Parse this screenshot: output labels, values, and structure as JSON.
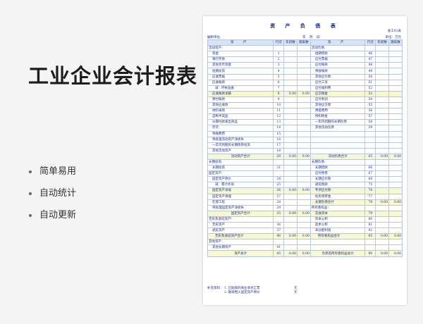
{
  "promo": {
    "title": "工业企业会计报表",
    "features": [
      "简单易用",
      "自动统计",
      "自动更新"
    ]
  },
  "sheet": {
    "title": "资 产 负 债 表",
    "form_no": "会工01表",
    "unit_label": "编制单位:",
    "date_text": "年 月 日",
    "money_unit": "单位：万元",
    "headers": {
      "asset": "资 产",
      "line": "行次",
      "begin": "年初数",
      "end": "期末数",
      "liability": "资 产",
      "line2": "行次",
      "begin2": "年初数",
      "end2": "期末数"
    },
    "rows": [
      {
        "a": "流动资产:",
        "an": "",
        "ab": "",
        "ae": "",
        "l": "流动负债:",
        "ln": "",
        "lb": "",
        "le": "",
        "ai": 0,
        "li": 0,
        "hl": false
      },
      {
        "a": "现金",
        "an": "1",
        "ab": "",
        "ae": "",
        "l": "短期借款",
        "ln": "46",
        "lb": "",
        "le": "",
        "ai": 1,
        "li": 1,
        "hl": false
      },
      {
        "a": "银行存款",
        "an": "2",
        "ab": "",
        "ae": "",
        "l": "应付票据",
        "ln": "47",
        "lb": "",
        "le": "",
        "ai": 1,
        "li": 1,
        "hl": false
      },
      {
        "a": "其他货币资金",
        "an": "3",
        "ab": "",
        "ae": "",
        "l": "应付账款",
        "ln": "48",
        "lb": "",
        "le": "",
        "ai": 1,
        "li": 1,
        "hl": false
      },
      {
        "a": "短期投资",
        "an": "4",
        "ab": "",
        "ae": "",
        "l": "预收账款",
        "ln": "49",
        "lb": "",
        "le": "",
        "ai": 1,
        "li": 1,
        "hl": false
      },
      {
        "a": "应收票据",
        "an": "5",
        "ab": "",
        "ae": "",
        "l": "其他应付款",
        "ln": "50",
        "lb": "",
        "le": "",
        "ai": 1,
        "li": 1,
        "hl": false
      },
      {
        "a": "应收账款",
        "an": "6",
        "ab": "",
        "ae": "",
        "l": "应付工资",
        "ln": "51",
        "lb": "",
        "le": "",
        "ai": 1,
        "li": 1,
        "hl": false
      },
      {
        "a": "减：坏帐准备",
        "an": "7",
        "ab": "",
        "ae": "",
        "l": "应付福利费",
        "ln": "52",
        "lb": "",
        "le": "",
        "ai": 2,
        "li": 1,
        "hl": false
      },
      {
        "a": "应收账款净额",
        "an": "8",
        "ab": "0.00",
        "ae": "0.00",
        "l": "应交税金",
        "ln": "53",
        "lb": "",
        "le": "",
        "ai": 1,
        "li": 1,
        "hl": true
      },
      {
        "a": "预付账款",
        "an": "9",
        "ab": "",
        "ae": "",
        "l": "应付利润",
        "ln": "54",
        "lb": "",
        "le": "",
        "ai": 1,
        "li": 1,
        "hl": false
      },
      {
        "a": "其他应收款",
        "an": "10",
        "ab": "",
        "ae": "",
        "l": "其他应交款",
        "ln": "55",
        "lb": "",
        "le": "",
        "ai": 1,
        "li": 1,
        "hl": false
      },
      {
        "a": "材料采购",
        "an": "11",
        "ab": "",
        "ae": "",
        "l": "预提费用",
        "ln": "56",
        "lb": "",
        "le": "",
        "ai": 1,
        "li": 1,
        "hl": false
      },
      {
        "a": "自制半成品",
        "an": "12",
        "ab": "",
        "ae": "",
        "l": "待扣税金",
        "ln": "57",
        "lb": "",
        "le": "",
        "ai": 1,
        "li": 1,
        "hl": false
      },
      {
        "a": "分期付款发出商品",
        "an": "13",
        "ab": "",
        "ae": "",
        "l": "一年内到期的长期负债",
        "ln": "58",
        "lb": "",
        "le": "",
        "ai": 1,
        "li": 1,
        "hl": false
      },
      {
        "a": "存货",
        "an": "14",
        "ab": "",
        "ae": "",
        "l": "其他流动负债",
        "ln": "59",
        "lb": "",
        "le": "",
        "ai": 1,
        "li": 1,
        "hl": false
      },
      {
        "a": "待摊费用",
        "an": "15",
        "ab": "",
        "ae": "",
        "l": "",
        "ln": "",
        "lb": "",
        "le": "",
        "ai": 1,
        "li": 1,
        "hl": false
      },
      {
        "a": "待处理流动资产净损失",
        "an": "16",
        "ab": "",
        "ae": "",
        "l": "",
        "ln": "",
        "lb": "",
        "le": "",
        "ai": 1,
        "li": 1,
        "hl": false
      },
      {
        "a": "一年内到期的长期债券投资",
        "an": "17",
        "ab": "",
        "ae": "",
        "l": "",
        "ln": "",
        "lb": "",
        "le": "",
        "ai": 1,
        "li": 1,
        "hl": false
      },
      {
        "a": "其他流动资产",
        "an": "18",
        "ab": "",
        "ae": "",
        "l": "",
        "ln": "",
        "lb": "",
        "le": "",
        "ai": 1,
        "li": 1,
        "hl": false
      },
      {
        "a": "流动资产合计",
        "an": "20",
        "ab": "0.00",
        "ae": "0.00",
        "l": "流动负债合计",
        "ln": "65",
        "lb": "0.00",
        "le": "0.00",
        "ai": 3,
        "li": 3,
        "hl": true
      },
      {
        "a": "长期投资:",
        "an": "",
        "ab": "",
        "ae": "",
        "l": "长期负债:",
        "ln": "",
        "lb": "",
        "le": "",
        "ai": 0,
        "li": 0,
        "hl": false
      },
      {
        "a": "长期投资",
        "an": "21",
        "ab": "",
        "ae": "",
        "l": "长期借款",
        "ln": "66",
        "lb": "",
        "le": "",
        "ai": 1,
        "li": 1,
        "hl": false
      },
      {
        "a": "固定资产:",
        "an": "",
        "ab": "",
        "ae": "",
        "l": "应付债券",
        "ln": "67",
        "lb": "",
        "le": "",
        "ai": 0,
        "li": 1,
        "hl": false
      },
      {
        "a": "固定资产原价",
        "an": "24",
        "ab": "",
        "ae": "",
        "l": "长期应付款",
        "ln": "68",
        "lb": "",
        "le": "",
        "ai": 1,
        "li": 1,
        "hl": false
      },
      {
        "a": "减：累计折旧",
        "an": "25",
        "ab": "",
        "ae": "",
        "l": "递延税款",
        "ln": "75",
        "lb": "",
        "le": "",
        "ai": 2,
        "li": 1,
        "hl": false
      },
      {
        "a": "固定资产净值",
        "an": "26",
        "ab": "0.00",
        "ae": "0.00",
        "l": "专项应付款",
        "ln": "76",
        "lb": "",
        "le": "",
        "ai": 1,
        "li": 1,
        "hl": true
      },
      {
        "a": "固定资产清理",
        "an": "27",
        "ab": "",
        "ae": "",
        "l": "住房周转金",
        "ln": "77",
        "lb": "",
        "le": "",
        "ai": 1,
        "li": 1,
        "hl": false
      },
      {
        "a": "在建工程",
        "an": "28",
        "ab": "",
        "ae": "",
        "l": "长期负债合计",
        "ln": "78",
        "lb": "0.00",
        "le": "0.00",
        "ai": 1,
        "li": 1,
        "hl": false,
        "hl_right": true
      },
      {
        "a": "待处理固定资产净损失",
        "an": "29",
        "ab": "",
        "ae": "",
        "l": "所有者权益：",
        "ln": "",
        "lb": "",
        "le": "",
        "ai": 1,
        "li": 0,
        "hl": false
      },
      {
        "a": "固定资产合计",
        "an": "35",
        "ab": "0.00",
        "ae": "0.00",
        "l": "实收资本",
        "ln": "79",
        "lb": "",
        "le": "",
        "ai": 3,
        "li": 1,
        "hl": true
      },
      {
        "a": "无形及递延资产：",
        "an": "",
        "ab": "",
        "ae": "",
        "l": "资本公积",
        "ln": "80",
        "lb": "",
        "le": "",
        "ai": 0,
        "li": 1,
        "hl": false
      },
      {
        "a": "无形资产",
        "an": "36",
        "ab": "",
        "ae": "",
        "l": "盈余公积",
        "ln": "81",
        "lb": "",
        "le": "",
        "ai": 1,
        "li": 1,
        "hl": false
      },
      {
        "a": "递延资产",
        "an": "37",
        "ab": "",
        "ae": "",
        "l": "未分配利润",
        "ln": "82",
        "lb": "",
        "le": "",
        "ai": 1,
        "li": 1,
        "hl": false
      },
      {
        "a": "无形及递延资产合计",
        "an": "40",
        "ab": "0.00",
        "ae": "0.00",
        "l": "所有者权益合计",
        "ln": "85",
        "lb": "0.00",
        "le": "0.00",
        "ai": 2,
        "li": 2,
        "hl": true
      },
      {
        "a": "其他资产：",
        "an": "",
        "ab": "",
        "ae": "",
        "l": "",
        "ln": "",
        "lb": "",
        "le": "",
        "ai": 0,
        "li": 0,
        "hl": false
      },
      {
        "a": "其他长期资产",
        "an": "41",
        "ab": "",
        "ae": "",
        "l": "",
        "ln": "",
        "lb": "",
        "le": "",
        "ai": 1,
        "li": 0,
        "hl": false
      },
      {
        "a": "资产总计",
        "an": "45",
        "ab": "0.00",
        "ae": "0.00",
        "l": "负债及所有者权益总计",
        "ln": "90",
        "lb": "0.00",
        "le": "0.00",
        "ai": 3,
        "li": 3,
        "hl": true
      }
    ],
    "supplement": {
      "label": "补充资料：",
      "item1": "1. 已贴现的商业承兑汇票",
      "item2": "2. 融资租入固定资产原价",
      "unit1": "元",
      "unit2": "元"
    }
  }
}
